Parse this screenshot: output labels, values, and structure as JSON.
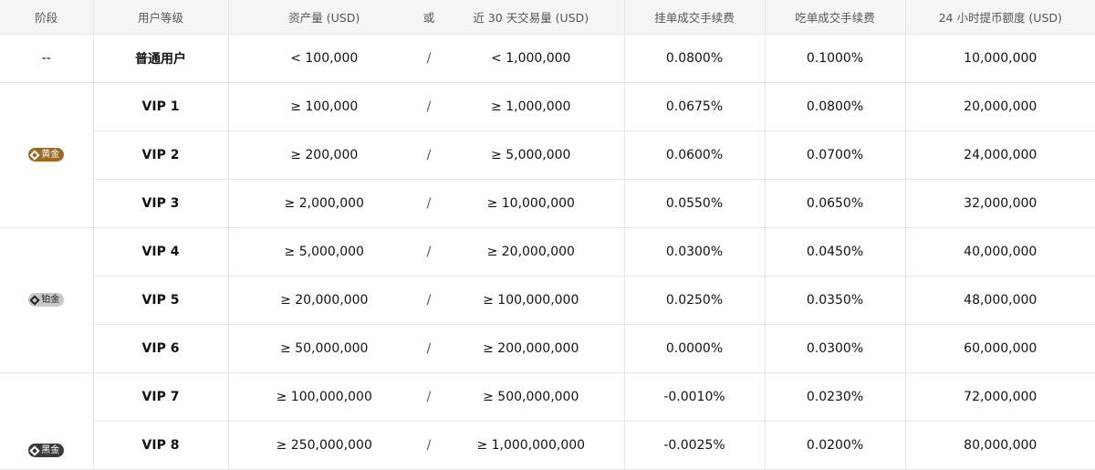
{
  "headers": {
    "stage": "阶段",
    "level": "用户等级",
    "asset": "资产量 (USD)",
    "or": "或",
    "volume": "近 30 天交易量 (USD)",
    "maker": "挂单成交手续费",
    "taker": "吃单成交手续费",
    "withdraw": "24 小时提币额度 (USD)"
  },
  "stages": {
    "none": "--",
    "gold": "黄金",
    "platinum": "铂金",
    "black": "黑金"
  },
  "rows": [
    {
      "level": "普通用户",
      "asset": "< 100,000",
      "sep": "/",
      "volume": "< 1,000,000",
      "maker": "0.0800%",
      "taker": "0.1000%",
      "withdraw": "10,000,000"
    },
    {
      "level": "VIP 1",
      "asset": "≥ 100,000",
      "sep": "/",
      "volume": "≥ 1,000,000",
      "maker": "0.0675%",
      "taker": "0.0800%",
      "withdraw": "20,000,000"
    },
    {
      "level": "VIP 2",
      "asset": "≥ 200,000",
      "sep": "/",
      "volume": "≥ 5,000,000",
      "maker": "0.0600%",
      "taker": "0.0700%",
      "withdraw": "24,000,000"
    },
    {
      "level": "VIP 3",
      "asset": "≥ 2,000,000",
      "sep": "/",
      "volume": "≥ 10,000,000",
      "maker": "0.0550%",
      "taker": "0.0650%",
      "withdraw": "32,000,000"
    },
    {
      "level": "VIP 4",
      "asset": "≥ 5,000,000",
      "sep": "/",
      "volume": "≥ 20,000,000",
      "maker": "0.0300%",
      "taker": "0.0450%",
      "withdraw": "40,000,000"
    },
    {
      "level": "VIP 5",
      "asset": "≥ 20,000,000",
      "sep": "/",
      "volume": "≥ 100,000,000",
      "maker": "0.0250%",
      "taker": "0.0350%",
      "withdraw": "48,000,000"
    },
    {
      "level": "VIP 6",
      "asset": "≥ 50,000,000",
      "sep": "/",
      "volume": "≥ 200,000,000",
      "maker": "0.0000%",
      "taker": "0.0300%",
      "withdraw": "60,000,000"
    },
    {
      "level": "VIP 7",
      "asset": "≥ 100,000,000",
      "sep": "/",
      "volume": "≥ 500,000,000",
      "maker": "-0.0010%",
      "taker": "0.0230%",
      "withdraw": "72,000,000"
    },
    {
      "level": "VIP 8",
      "asset": "≥ 250,000,000",
      "sep": "/",
      "volume": "≥ 1,000,000,000",
      "maker": "-0.0025%",
      "taker": "0.0200%",
      "withdraw": "80,000,000"
    }
  ],
  "colors": {
    "gold_badge": "#9a6a20",
    "platinum_badge": "#c8c8c8",
    "black_badge": "#3a3a3a",
    "header_bg": "#f5f5f5"
  }
}
